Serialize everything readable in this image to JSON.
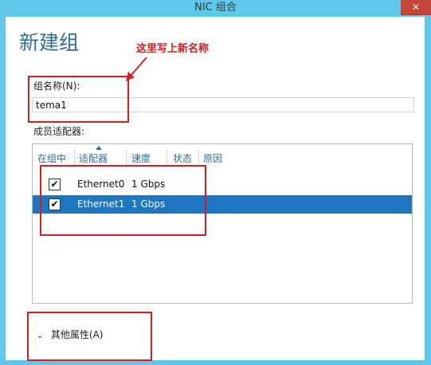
{
  "window": {
    "title": "NIC 组合",
    "close_glyph": "✕"
  },
  "page": {
    "title": "新建组"
  },
  "annotation": {
    "text": "这里写上新名称"
  },
  "form": {
    "name_label": "组名称(N):",
    "name_value": "tema1",
    "members_label": "成员适配器:"
  },
  "table": {
    "columns": [
      "在组中",
      "适配器",
      "速度",
      "状态",
      "原因"
    ],
    "rows": [
      {
        "checked": true,
        "checkmark": "✔",
        "adapter": "Ethernet0",
        "speed": "1 Gbps",
        "selected": false
      },
      {
        "checked": true,
        "checkmark": "✔",
        "adapter": "Ethernet1",
        "speed": "1 Gbps",
        "selected": true
      }
    ]
  },
  "more": {
    "chevron": "⌄",
    "label": "其他属性(A)"
  },
  "colors": {
    "titlebar": "#62c8ea",
    "accent": "#2e6f92",
    "selection": "#1e75c0",
    "annotation_red": "#d62020"
  }
}
